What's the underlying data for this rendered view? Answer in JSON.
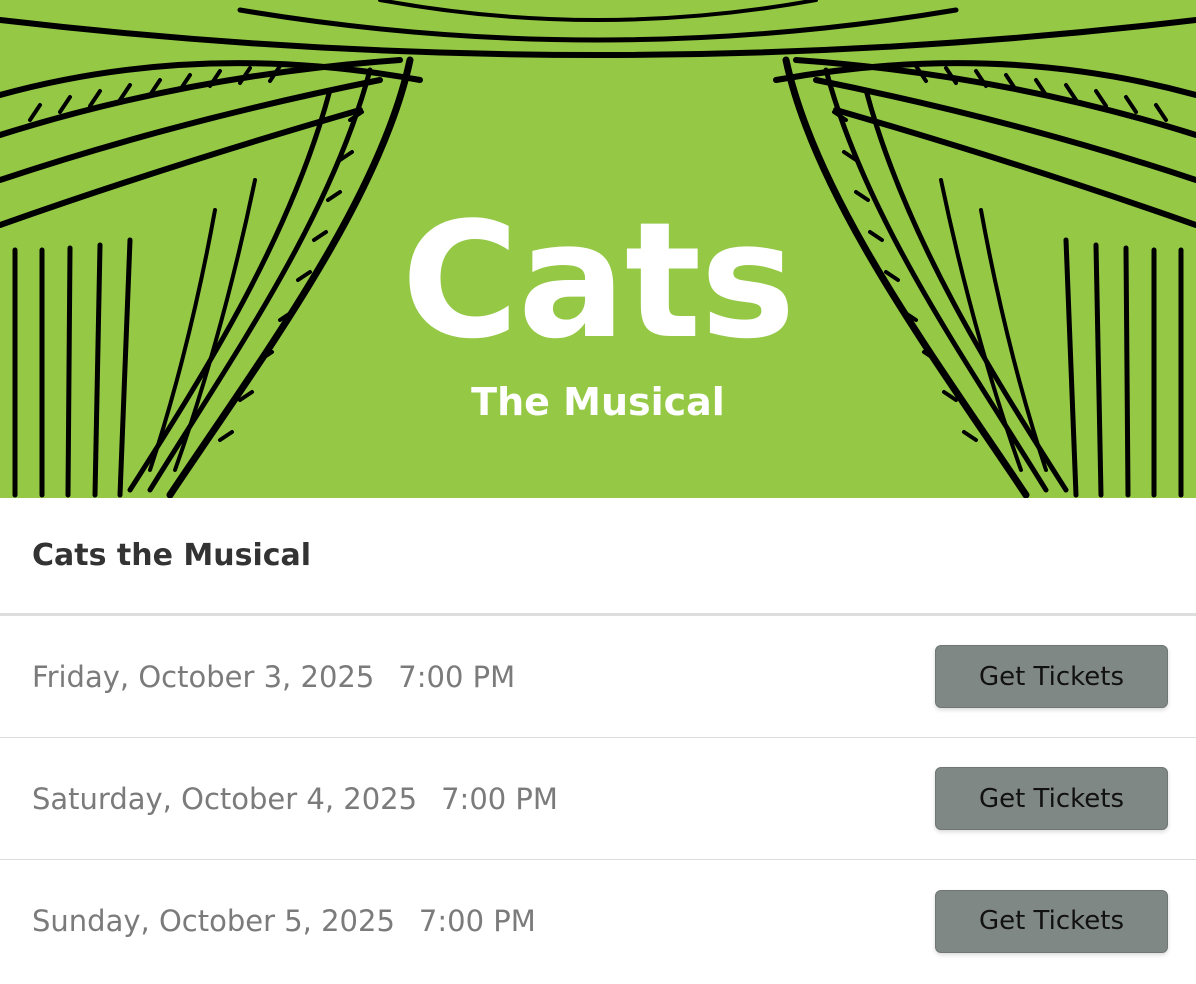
{
  "hero": {
    "title": "Cats",
    "subtitle": "The Musical",
    "background_color": "#94c845",
    "line_color": "#000000"
  },
  "event": {
    "title": "Cats the Musical"
  },
  "showtimes": [
    {
      "date": "Friday, October 3, 2025",
      "time": "7:00 PM",
      "button_label": "Get Tickets"
    },
    {
      "date": "Saturday, October 4, 2025",
      "time": "7:00 PM",
      "button_label": "Get Tickets"
    },
    {
      "date": "Sunday, October 5, 2025",
      "time": "7:00 PM",
      "button_label": "Get Tickets"
    }
  ]
}
